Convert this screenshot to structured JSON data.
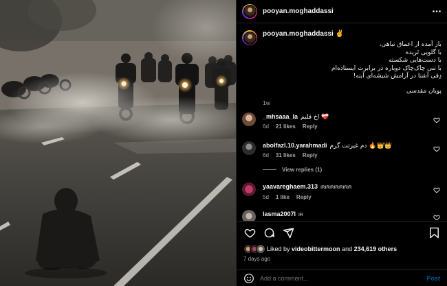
{
  "post": {
    "username": "pooyan.moghaddassi",
    "caption_username": "pooyan.moghaddassi",
    "caption_badge": "✌️",
    "caption_lines": [
      "باز آمده از اعماق تباهی،",
      "با گلویی تَریده",
      "با دست‌هایی شکسته",
      "با تنی چاک‌چاک دوباره در برابرت ایستاده‌ام",
      "دِقی آشنا در آرامش شیشه‌ای آینه!"
    ],
    "caption_signature": "پویان مقدسی",
    "caption_time": "1w"
  },
  "comments": [
    {
      "username": "_mhsaaa_la",
      "text": "اخ قلبم ❤️‍🩹",
      "time": "6d",
      "likes": "21 likes",
      "reply": "Reply"
    },
    {
      "username": "abolfazl.10.yarahmadi",
      "text": "دم غیرتت گرم 🔥👑👑",
      "time": "6d",
      "likes": "31 likes",
      "reply": "Reply"
    },
    {
      "username": "yaavareghaem.313",
      "text": "IRIRIRIRIRIRIR",
      "time": "5d",
      "likes": "1 like",
      "reply": "Reply"
    },
    {
      "username": "lasma2007l",
      "text": "IR",
      "time": "",
      "likes": "",
      "reply": ""
    }
  ],
  "view_replies": "View replies (1)",
  "likes": {
    "prefix": "Liked by",
    "user": "videobittermoon",
    "joiner": "and",
    "count": "234,619 others"
  },
  "date": "7 days ago",
  "add_comment": {
    "placeholder": "Add a comment...",
    "post_label": "Post"
  },
  "colors": {
    "link": "#0095f6",
    "heart_red": "#ed4956",
    "muted": "#a8a8a8"
  },
  "icons": [
    "more-icon",
    "heart-icon",
    "comment-icon",
    "share-icon",
    "bookmark-icon",
    "emoji-icon"
  ]
}
